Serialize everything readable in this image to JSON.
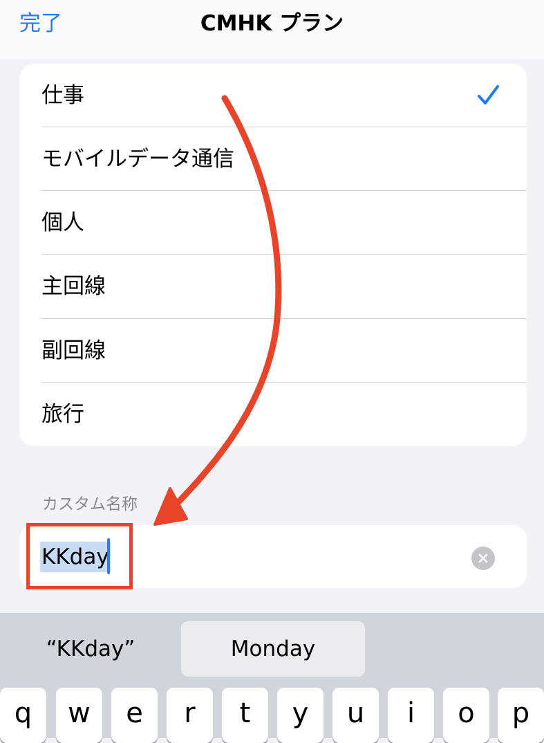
{
  "nav": {
    "done_label": "完了",
    "title": "CMHK プラン"
  },
  "options": [
    {
      "label": "仕事",
      "selected": true
    },
    {
      "label": "モバイルデータ通信",
      "selected": false
    },
    {
      "label": "個人",
      "selected": false
    },
    {
      "label": "主回線",
      "selected": false
    },
    {
      "label": "副回線",
      "selected": false
    },
    {
      "label": "旅行",
      "selected": false
    }
  ],
  "custom": {
    "header": "カスタム名称",
    "value": "KKday"
  },
  "keyboard": {
    "suggestions": [
      "“KKday”",
      "Monday",
      ""
    ],
    "keys": [
      "q",
      "w",
      "e",
      "r",
      "t",
      "y",
      "u",
      "i",
      "o",
      "p"
    ]
  },
  "colors": {
    "accent": "#1f7cf6",
    "annotation": "#e8442a"
  },
  "icons": {
    "check": "checkmark-icon",
    "clear": "clear-text-icon"
  }
}
